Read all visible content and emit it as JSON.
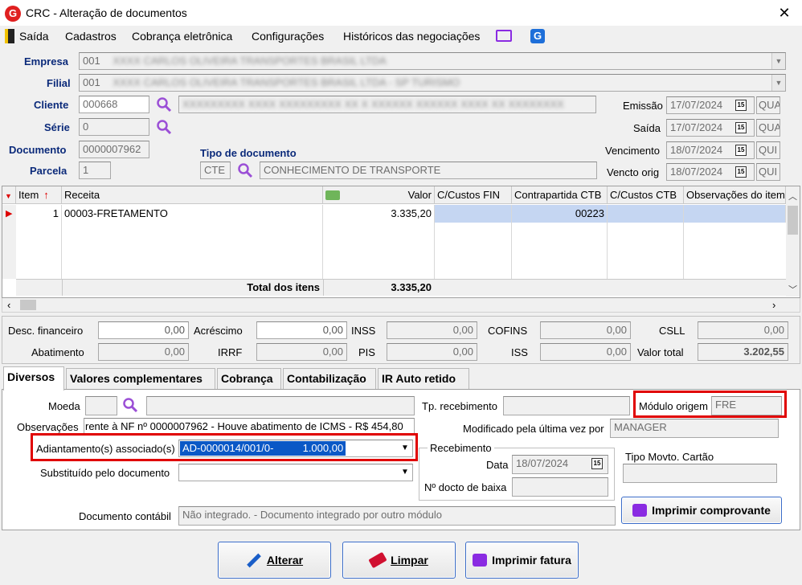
{
  "window": {
    "title": "CRC - Alteração de documentos",
    "close": "✕"
  },
  "menu": [
    "Saída",
    "Cadastros",
    "Cobrança eletrônica",
    "Configurações",
    "Históricos das negociações"
  ],
  "header": {
    "empresa": {
      "label": "Empresa",
      "code": "001",
      "name": "XXXX CARLOS OLIVEIRA TRANSPORTES BRASIL LTDA"
    },
    "filial": {
      "label": "Filial",
      "code": "001",
      "name": "XXXX CARLOS OLIVEIRA TRANSPORTES BRASIL LTDA - SP TURISMO"
    },
    "cliente": {
      "label": "Cliente",
      "code": "000668",
      "name": "XXXXXXXXX XXXX XXXXXXXXX XX X XXXXXX XXXXXX XXXX XX XXXXXXXX"
    },
    "serie": {
      "label": "Série",
      "value": "0"
    },
    "documento": {
      "label": "Documento",
      "value": "0000007962"
    },
    "parcela": {
      "label": "Parcela",
      "value": "1"
    },
    "tipo_doc": {
      "label": "Tipo de documento",
      "code": "CTE",
      "name": "CONHECIMENTO DE TRANSPORTE"
    },
    "emissao": {
      "label": "Emissão",
      "date": "17/07/2024",
      "day": "QUA"
    },
    "saida": {
      "label": "Saída",
      "date": "17/07/2024",
      "day": "QUA"
    },
    "vencimento": {
      "label": "Vencimento",
      "date": "18/07/2024",
      "day": "QUI"
    },
    "vencto_orig": {
      "label": "Vencto orig",
      "date": "18/07/2024",
      "day": "QUI"
    },
    "cal_label": "15"
  },
  "grid": {
    "headers": [
      "Item",
      "Receita",
      "Valor",
      "C/Custos FIN",
      "Contrapartida CTB",
      "C/Custos CTB",
      "Observações do item"
    ],
    "rows": [
      {
        "item": "1",
        "receita": "00003-FRETAMENTO",
        "valor": "3.335,20",
        "contrapartida": "00223"
      }
    ],
    "total_label": "Total dos itens",
    "total_value": "3.335,20"
  },
  "totals": {
    "desc_fin": {
      "label": "Desc. financeiro",
      "value": "0,00"
    },
    "acrescimo": {
      "label": "Acréscimo",
      "value": "0,00"
    },
    "inss": {
      "label": "INSS",
      "value": "0,00"
    },
    "cofins": {
      "label": "COFINS",
      "value": "0,00"
    },
    "csll": {
      "label": "CSLL",
      "value": "0,00"
    },
    "abatimento": {
      "label": "Abatimento",
      "value": "0,00"
    },
    "irrf": {
      "label": "IRRF",
      "value": "0,00"
    },
    "pis": {
      "label": "PIS",
      "value": "0,00"
    },
    "iss": {
      "label": "ISS",
      "value": "0,00"
    },
    "valor_total": {
      "label": "Valor total",
      "value": "3.202,55"
    }
  },
  "tabs": [
    "Diversos",
    "Valores complementares",
    "Cobrança",
    "Contabilização",
    "IR Auto retido"
  ],
  "diversos": {
    "moeda_label": "Moeda",
    "tp_recebimento_label": "Tp. recebimento",
    "modulo_origem_label": "Módulo origem",
    "modulo_origem_value": "FRE",
    "observacoes_label": "Observações",
    "observacoes_value": "rente à NF nº 0000007962 - Houve abatimento de ICMS - R$ 454,80",
    "modificado_label": "Modificado pela última vez por",
    "modificado_value": "MANAGER",
    "adiantamento_label": "Adiantamento(s) associado(s)",
    "adiantamento_value": "AD-0000014/001/0-          1.000,00",
    "recebimento_label": "Recebimento",
    "data_label": "Data",
    "data_value": "18/07/2024",
    "tipo_movto_label": "Tipo Movto. Cartão",
    "substituido_label": "Substituído pelo documento",
    "docto_baixa_label": "Nº docto de baixa",
    "doc_contabil_label": "Documento contábil",
    "doc_contabil_value": "Não integrado.  - Documento integrado por outro módulo",
    "imprimir_comprovante": "Imprimir comprovante"
  },
  "buttons": {
    "alterar": "Alterar",
    "limpar": "Limpar",
    "imprimir_fatura": "Imprimir fatura"
  },
  "colors": {
    "accent_blue": "#0b2a7a",
    "highlight_red": "#e00000",
    "selection": "#c5d6f2"
  }
}
